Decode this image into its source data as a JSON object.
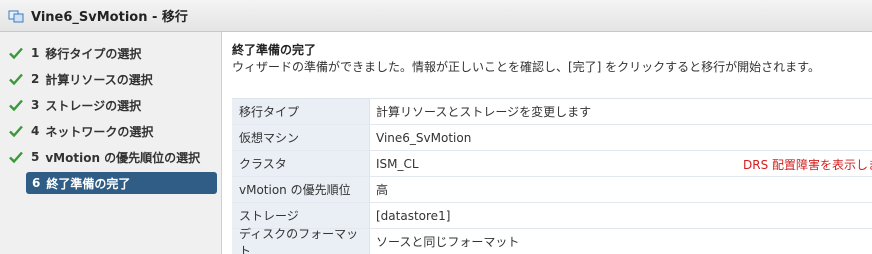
{
  "window": {
    "title": "Vine6_SvMotion - 移行"
  },
  "steps": [
    {
      "number": "1",
      "label": "移行タイプの選択",
      "completed": true
    },
    {
      "number": "2",
      "label": "計算リソースの選択",
      "completed": true
    },
    {
      "number": "3",
      "label": "ストレージの選択",
      "completed": true
    },
    {
      "number": "4",
      "label": "ネットワークの選択",
      "completed": true
    },
    {
      "number": "5",
      "label": "vMotion の優先順位の選択",
      "completed": true
    },
    {
      "number": "6",
      "label": "終了準備の完了",
      "completed": false,
      "active": true
    }
  ],
  "main": {
    "heading": "終了準備の完了",
    "description": "ウィザードの準備ができました。情報が正しいことを確認し、[完了] をクリックすると移行が開始されます。",
    "summary": [
      {
        "key": "移行タイプ",
        "value": "計算リソースとストレージを変更します"
      },
      {
        "key": "仮想マシン",
        "value": "Vine6_SvMotion"
      },
      {
        "key": "クラスタ",
        "value": "ISM_CL",
        "link": "DRS 配置障害を表示しま"
      },
      {
        "key": "vMotion の優先順位",
        "value": "高"
      },
      {
        "key": "ストレージ",
        "value": "[datastore1]"
      },
      {
        "key": "ディスクのフォーマット",
        "value": "ソースと同じフォーマット"
      }
    ]
  },
  "colors": {
    "check": "#3a9a3a",
    "active_step_bg": "#2f5d86",
    "warning_link": "#d21f1f"
  },
  "icons": {
    "app": "vm-migrate-icon",
    "step_done": "checkmark-icon"
  }
}
